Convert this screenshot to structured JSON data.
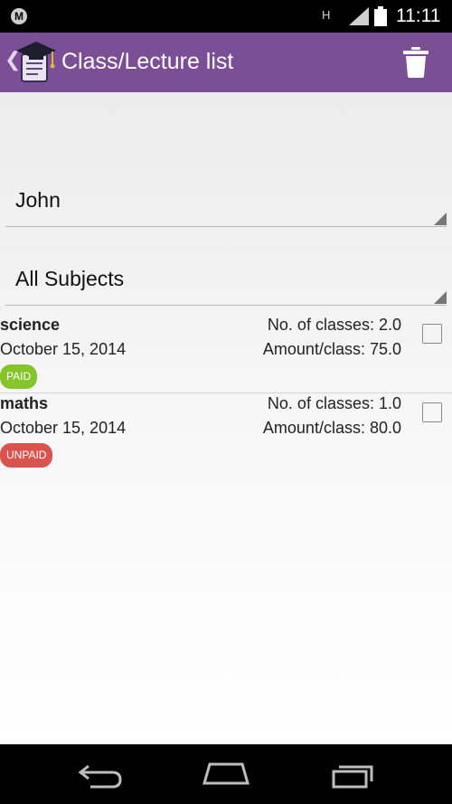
{
  "status_bar": {
    "time": "11:11",
    "network": "H"
  },
  "action_bar": {
    "title": "Class/Lecture list"
  },
  "filters": {
    "student": "John",
    "subject": "All Subjects"
  },
  "entries": [
    {
      "subject": "science",
      "date": "October 15, 2014",
      "classes": "No. of classes: 2.0",
      "amount": "Amount/class: 75.0",
      "status": "PAID"
    },
    {
      "subject": "maths",
      "date": "October 15, 2014",
      "classes": "No. of classes: 1.0",
      "amount": "Amount/class: 80.0",
      "status": "UNPAID"
    }
  ],
  "colors": {
    "action_bar": "#7b4f96",
    "paid": "#85c52b",
    "unpaid": "#d9534f"
  },
  "icons": [
    "motorola-icon",
    "signal-icon",
    "battery-icon",
    "back-caret-icon",
    "app-graduation-icon",
    "trash-icon",
    "nav-back-icon",
    "nav-home-icon",
    "nav-recents-icon"
  ]
}
